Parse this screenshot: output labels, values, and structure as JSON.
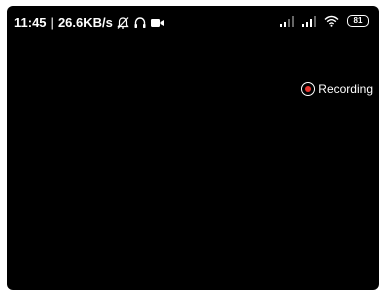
{
  "status_bar": {
    "time": "11:45",
    "separator": "|",
    "network_speed": "26.6KB/s",
    "icons_left": [
      "alarm-off-icon",
      "headphones-icon",
      "video-camera-icon"
    ],
    "icons_right": [
      "signal-weak-icon",
      "signal-icon",
      "wifi-icon"
    ],
    "battery_level": "81"
  },
  "recording": {
    "label": "Recording",
    "indicator_color": "#e8342e"
  },
  "colors": {
    "background": "#000000",
    "text": "#ffffff"
  }
}
